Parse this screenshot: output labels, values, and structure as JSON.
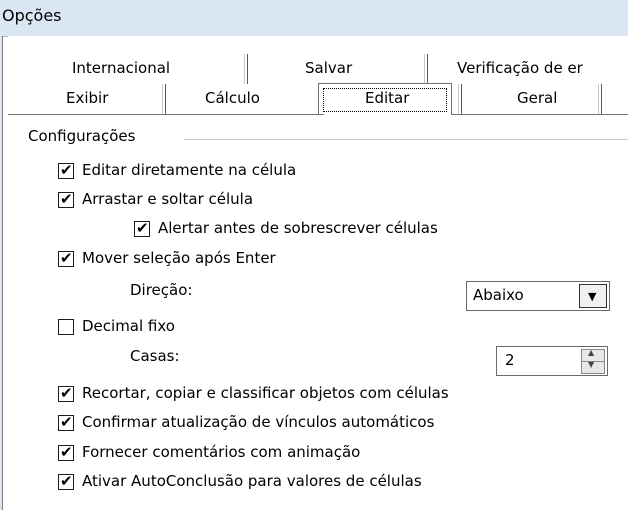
{
  "window": {
    "title": "Opções"
  },
  "tabs_back": [
    {
      "label": "Internacional"
    },
    {
      "label": "Salvar"
    },
    {
      "label": "Verificação de er"
    }
  ],
  "tabs_front": [
    {
      "label": "Exibir",
      "selected": false
    },
    {
      "label": "Cálculo",
      "selected": false
    },
    {
      "label": "Editar",
      "selected": true
    },
    {
      "label": "Geral",
      "selected": false
    }
  ],
  "group": {
    "title": "Configurações"
  },
  "options": [
    {
      "label": "Editar diretamente na célula",
      "checked": true
    },
    {
      "label": "Arrastar e soltar célula",
      "checked": true
    },
    {
      "label": "Alertar antes de sobrescrever células",
      "checked": true
    },
    {
      "label": "Mover seleção após Enter",
      "checked": true
    },
    {
      "label": "Decimal fixo",
      "checked": false
    },
    {
      "label": "Recortar, copiar e classificar objetos com células",
      "checked": true
    },
    {
      "label": "Confirmar atualização de vínculos automáticos",
      "checked": true
    },
    {
      "label": "Fornecer comentários com animação",
      "checked": true
    },
    {
      "label": "Ativar AutoConclusão para valores de células",
      "checked": true
    }
  ],
  "direction": {
    "label": "Direção:",
    "value": "Abaixo"
  },
  "places": {
    "label": "Casas:",
    "value": "2"
  },
  "glyphs": {
    "check": "✔",
    "dropdown": "▼",
    "spin_up": "▲",
    "spin_down": "▼"
  }
}
